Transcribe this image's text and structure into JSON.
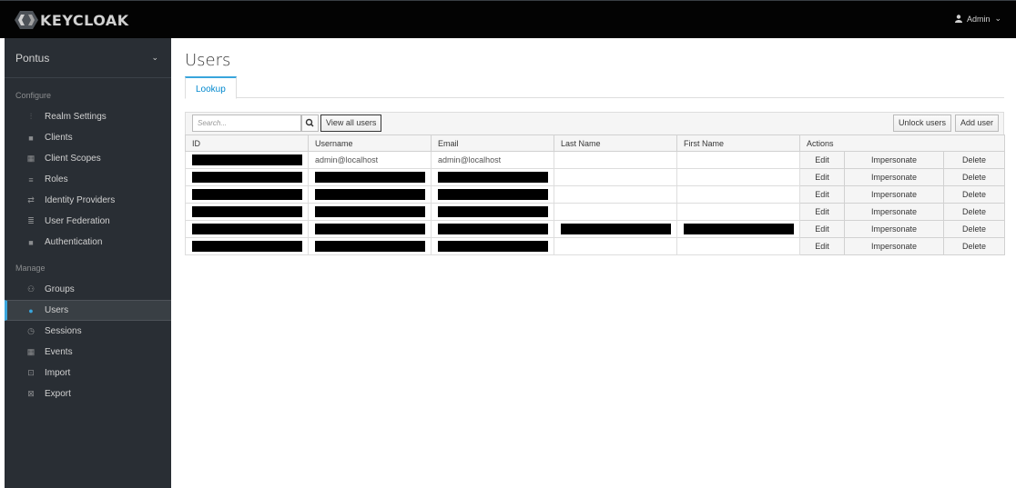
{
  "app": {
    "brand": "KEYCLOAK",
    "user_menu": "Admin"
  },
  "sidebar": {
    "realm": "Pontus",
    "configure_title": "Configure",
    "configure_items": [
      {
        "label": "Realm Settings",
        "icon": "sliders-icon"
      },
      {
        "label": "Clients",
        "icon": "cube-icon"
      },
      {
        "label": "Client Scopes",
        "icon": "cubes-icon"
      },
      {
        "label": "Roles",
        "icon": "list-icon"
      },
      {
        "label": "Identity Providers",
        "icon": "exchange-icon"
      },
      {
        "label": "User Federation",
        "icon": "database-icon"
      },
      {
        "label": "Authentication",
        "icon": "lock-icon"
      }
    ],
    "manage_title": "Manage",
    "manage_items": [
      {
        "label": "Groups",
        "icon": "users-icon"
      },
      {
        "label": "Users",
        "icon": "user-icon",
        "active": true
      },
      {
        "label": "Sessions",
        "icon": "clock-icon"
      },
      {
        "label": "Events",
        "icon": "calendar-icon"
      },
      {
        "label": "Import",
        "icon": "import-icon"
      },
      {
        "label": "Export",
        "icon": "export-icon"
      }
    ]
  },
  "main": {
    "title": "Users",
    "tab": "Lookup",
    "search_placeholder": "Search...",
    "view_all_label": "View all users",
    "unlock_label": "Unlock users",
    "add_label": "Add user"
  },
  "table": {
    "headers": [
      "ID",
      "Username",
      "Email",
      "Last Name",
      "First Name",
      "Actions"
    ],
    "rows": [
      {
        "id": null,
        "username": "admin@localhost",
        "email": "admin@localhost",
        "last": "",
        "first": ""
      },
      {
        "id": null,
        "username": null,
        "email": null,
        "last": "",
        "first": ""
      },
      {
        "id": null,
        "username": null,
        "email": null,
        "last": "",
        "first": ""
      },
      {
        "id": null,
        "username": null,
        "email": null,
        "last": "",
        "first": ""
      },
      {
        "id": null,
        "username": null,
        "email": null,
        "last": null,
        "first": null
      },
      {
        "id": null,
        "username": null,
        "email": null,
        "last": "",
        "first": ""
      }
    ],
    "actions": {
      "edit": "Edit",
      "impersonate": "Impersonate",
      "delete": "Delete"
    }
  }
}
